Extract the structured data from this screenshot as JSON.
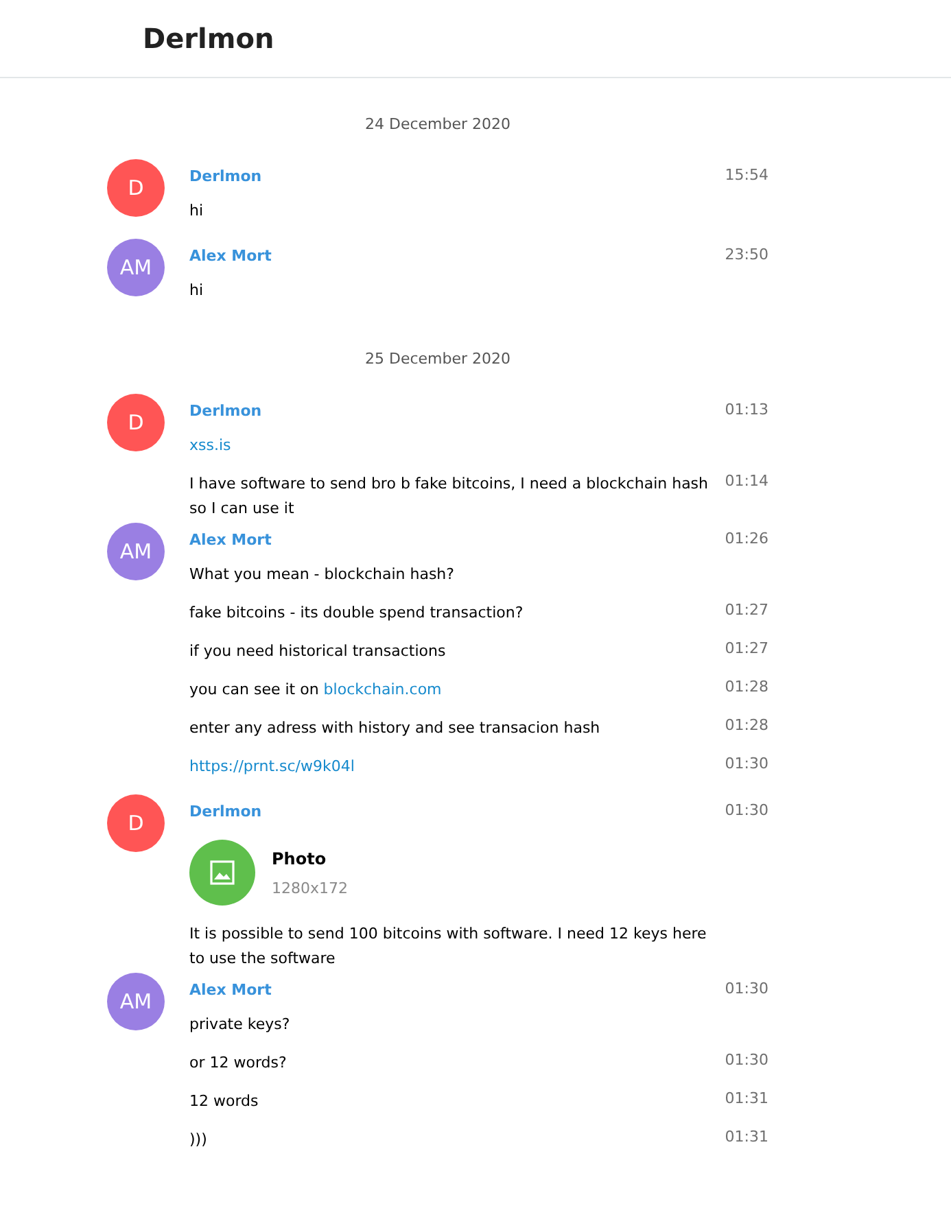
{
  "header": {
    "title": "Derlmon"
  },
  "history": [
    {
      "kind": "date",
      "text": "24 December 2020"
    },
    {
      "kind": "group",
      "author": "Derlmon",
      "initials": "D",
      "color": "#ff5555",
      "time": "15:54",
      "messages": [
        {
          "kind": "text",
          "segments": [
            {
              "kind": "plain",
              "text": "hi"
            }
          ]
        }
      ]
    },
    {
      "kind": "group",
      "author": "Alex Mort",
      "initials": "AM",
      "color": "#9a7fe3",
      "time": "23:50",
      "messages": [
        {
          "kind": "text",
          "segments": [
            {
              "kind": "plain",
              "text": "hi"
            }
          ]
        }
      ]
    },
    {
      "kind": "date",
      "text": "25 December 2020"
    },
    {
      "kind": "group",
      "author": "Derlmon",
      "initials": "D",
      "color": "#ff5555",
      "time": "01:13",
      "messages": [
        {
          "kind": "text",
          "segments": [
            {
              "kind": "link",
              "text": "xss.is"
            }
          ]
        },
        {
          "kind": "text",
          "time": "01:14",
          "segments": [
            {
              "kind": "plain",
              "text": "I have software to send bro b fake bitcoins, I need a blockchain hash so I can use it"
            }
          ]
        }
      ]
    },
    {
      "kind": "group",
      "author": "Alex Mort",
      "initials": "AM",
      "color": "#9a7fe3",
      "time": "01:26",
      "messages": [
        {
          "kind": "text",
          "segments": [
            {
              "kind": "plain",
              "text": "What you mean - blockchain hash?"
            }
          ]
        },
        {
          "kind": "text",
          "time": "01:27",
          "segments": [
            {
              "kind": "plain",
              "text": "fake bitcoins - its double spend transaction?"
            }
          ]
        },
        {
          "kind": "text",
          "time": "01:27",
          "segments": [
            {
              "kind": "plain",
              "text": "if you need historical transactions"
            }
          ]
        },
        {
          "kind": "text",
          "time": "01:28",
          "segments": [
            {
              "kind": "plain",
              "text": "you can see it on "
            },
            {
              "kind": "link",
              "text": "blockchain.com"
            }
          ]
        },
        {
          "kind": "text",
          "time": "01:28",
          "segments": [
            {
              "kind": "plain",
              "text": "enter any adress with history and see transacion hash"
            }
          ]
        },
        {
          "kind": "text",
          "time": "01:30",
          "segments": [
            {
              "kind": "link",
              "text": "https://prnt.sc/w9k04l"
            }
          ]
        }
      ]
    },
    {
      "kind": "group",
      "author": "Derlmon",
      "initials": "D",
      "color": "#ff5555",
      "time": "01:30",
      "messages": [
        {
          "kind": "photo",
          "title": "Photo",
          "details": "1280x172"
        },
        {
          "kind": "text",
          "segments": [
            {
              "kind": "plain",
              "text": "It is possible to send 100 bitcoins with software. I need 12 keys here to use the software"
            }
          ]
        }
      ]
    },
    {
      "kind": "group",
      "author": "Alex Mort",
      "initials": "AM",
      "color": "#9a7fe3",
      "time": "01:30",
      "messages": [
        {
          "kind": "text",
          "segments": [
            {
              "kind": "plain",
              "text": "private keys?"
            }
          ]
        },
        {
          "kind": "text",
          "time": "01:30",
          "segments": [
            {
              "kind": "plain",
              "text": "or 12 words?"
            }
          ]
        },
        {
          "kind": "text",
          "time": "01:31",
          "segments": [
            {
              "kind": "plain",
              "text": "12 words"
            }
          ]
        },
        {
          "kind": "text",
          "time": "01:31",
          "segments": [
            {
              "kind": "plain",
              "text": ")))"
            }
          ]
        }
      ]
    }
  ]
}
